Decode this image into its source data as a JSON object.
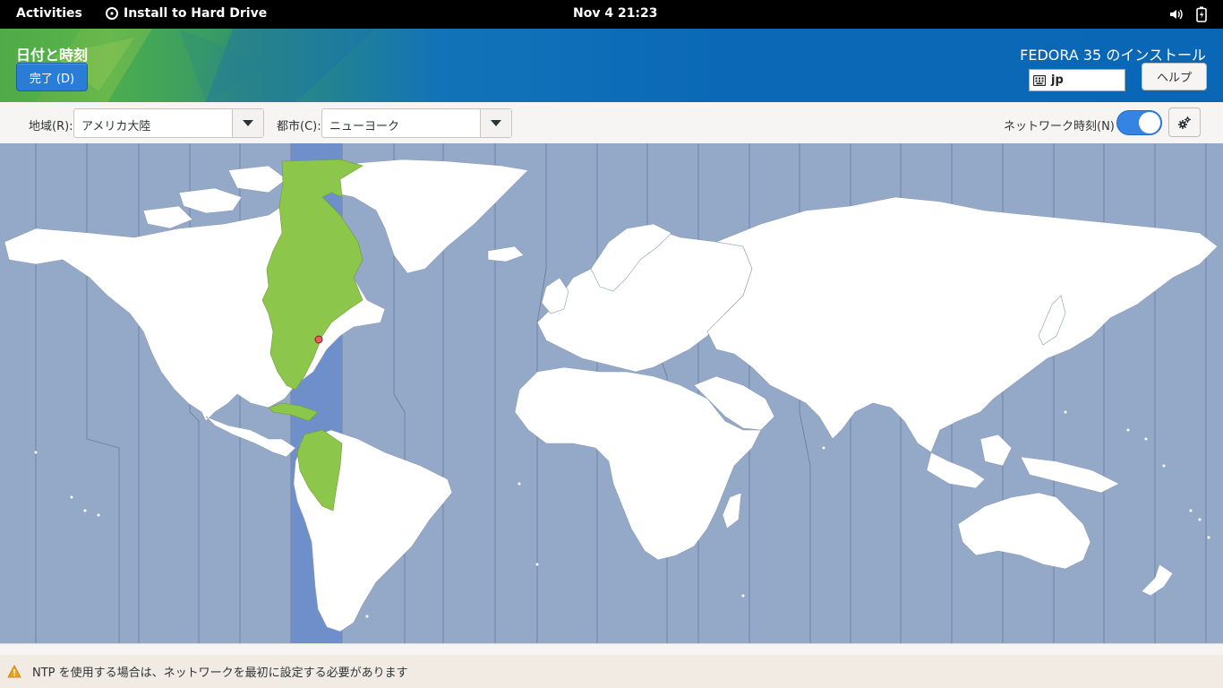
{
  "topbar": {
    "activities": "Activities",
    "app_name": "Install to Hard Drive",
    "clock": "Nov 4  21:23",
    "icons": [
      "volume-icon",
      "battery-icon"
    ]
  },
  "header": {
    "page_title": "日付と時刻",
    "done_label": "完了 (D)",
    "product_title": "FEDORA 35 のインストール",
    "keyboard_layout": "jp",
    "help_label": "ヘルプ"
  },
  "controls": {
    "region_label": "地域(R):",
    "region_value": "アメリカ大陸",
    "city_label": "都市(C):",
    "city_value": "ニューヨーク",
    "network_time_label": "ネットワーク時刻(N)",
    "network_time_enabled": true
  },
  "map": {
    "selected_city": "ニューヨーク",
    "highlight_color": "#8cc64a",
    "band_color": "#6f8fcb",
    "ocean_color": "#94a8c8"
  },
  "warning": {
    "text": "NTP を使用する場合は、ネットワークを最初に設定する必要があります"
  },
  "colors": {
    "accent": "#3584e4",
    "header_blue": "#0a67b5",
    "header_green": "#56b34a"
  }
}
